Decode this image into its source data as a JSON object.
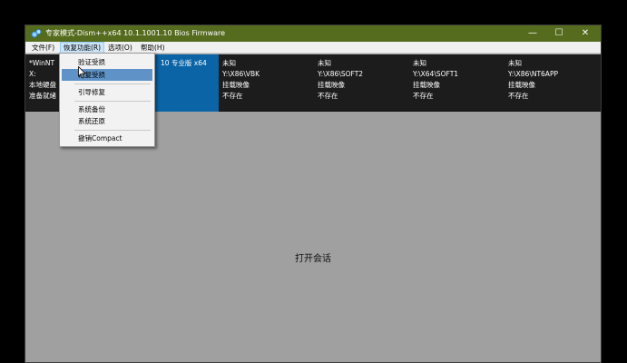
{
  "window": {
    "title": "专家模式-Dism++x64 10.1.1001.10 Bios Firmware",
    "controls": {
      "minimize": "—",
      "maximize": "☐",
      "close": "✕"
    },
    "titlebar_color": "#556b1e"
  },
  "menubar": {
    "items": [
      {
        "label": "文件(F)"
      },
      {
        "label": "恢复功能(R)"
      },
      {
        "label": "选项(O)"
      },
      {
        "label": "帮助(H)"
      }
    ]
  },
  "recovery_menu": {
    "items": [
      {
        "label": "验证受损"
      },
      {
        "label": "修复受损"
      },
      {
        "label": "引导修复"
      },
      {
        "label": "系统备份"
      },
      {
        "label": "系统还原"
      },
      {
        "label": "撤销Compact"
      }
    ],
    "highlight_color": "#5f93c7"
  },
  "sessions": [
    {
      "line1": "*WinNT",
      "line2": "X:",
      "line3": "本地硬盘",
      "line4": "准备就绪",
      "extra": "10 专业版 x64"
    },
    {
      "line1": "未知",
      "line2": "Y:\\X86\\VBK",
      "line3": "挂载映像",
      "line4": "不存在"
    },
    {
      "line1": "未知",
      "line2": "Y:\\X86\\SOFT2",
      "line3": "挂载映像",
      "line4": "不存在"
    },
    {
      "line1": "未知",
      "line2": "Y:\\X64\\SOFT1",
      "line3": "挂载映像",
      "line4": "不存在"
    },
    {
      "line1": "未知",
      "line2": "Y:\\X86\\NT6APP",
      "line3": "挂载映像",
      "line4": "不存在"
    }
  ],
  "active_session_color": "#0a64a6",
  "content": {
    "empty_message": "打开会话"
  }
}
